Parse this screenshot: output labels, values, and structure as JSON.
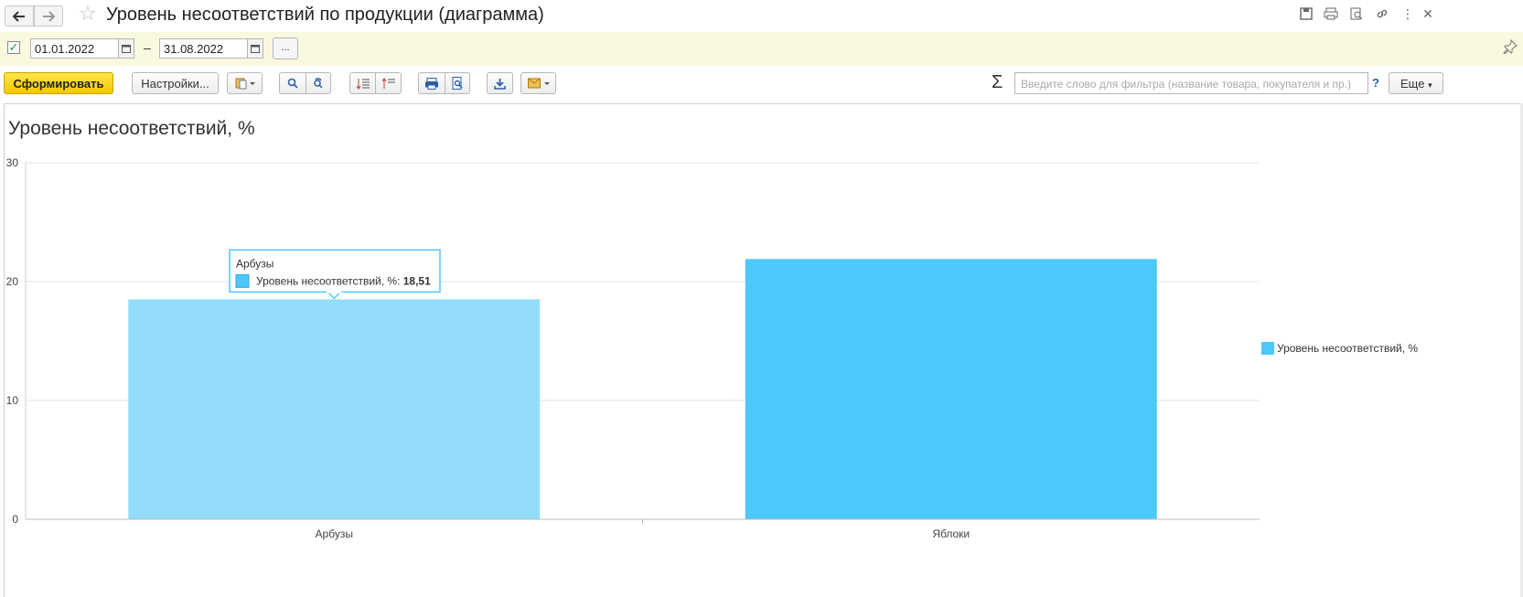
{
  "window": {
    "title": "Уровень несоответствий по продукции (диаграмма)",
    "back_icon": "arrow-left-icon",
    "forward_icon": "arrow-right-icon",
    "favorite_icon": "star-icon",
    "actions": [
      "save-icon",
      "print-icon",
      "preview-icon",
      "link-icon",
      "more-vert-icon",
      "close-icon"
    ]
  },
  "period": {
    "enabled": true,
    "start": "01.01.2022",
    "end": "31.08.2022",
    "separator": "–",
    "choose_label": "..."
  },
  "toolbar": {
    "generate_label": "Сформировать",
    "settings_label": "Настройки...",
    "filter_placeholder": "Введите слово для фильтра (название товара, покупателя и пр.)",
    "help_label": "?",
    "more_label": "Еще",
    "sigma_label": "Σ"
  },
  "colors": {
    "bar": "#4dc8fb",
    "bar_highlight": "#94dcfb",
    "tooltip_border": "#4dc8fb",
    "primary_button": "#f7d000"
  },
  "chart_data": {
    "type": "bar",
    "title": "Уровень несоответствий, %",
    "categories": [
      "Арбузы",
      "Яблоки"
    ],
    "series": [
      {
        "name": "Уровень несоответствий, %",
        "values": [
          18.51,
          21.9
        ]
      }
    ],
    "ylim": [
      0,
      30
    ],
    "yticks": [
      0,
      10,
      20,
      30
    ],
    "grid": true,
    "legend": "right",
    "highlighted": 0,
    "tooltip": {
      "category": "Арбузы",
      "series": "Уровень несоответствий, %:",
      "value": "18,51"
    }
  }
}
